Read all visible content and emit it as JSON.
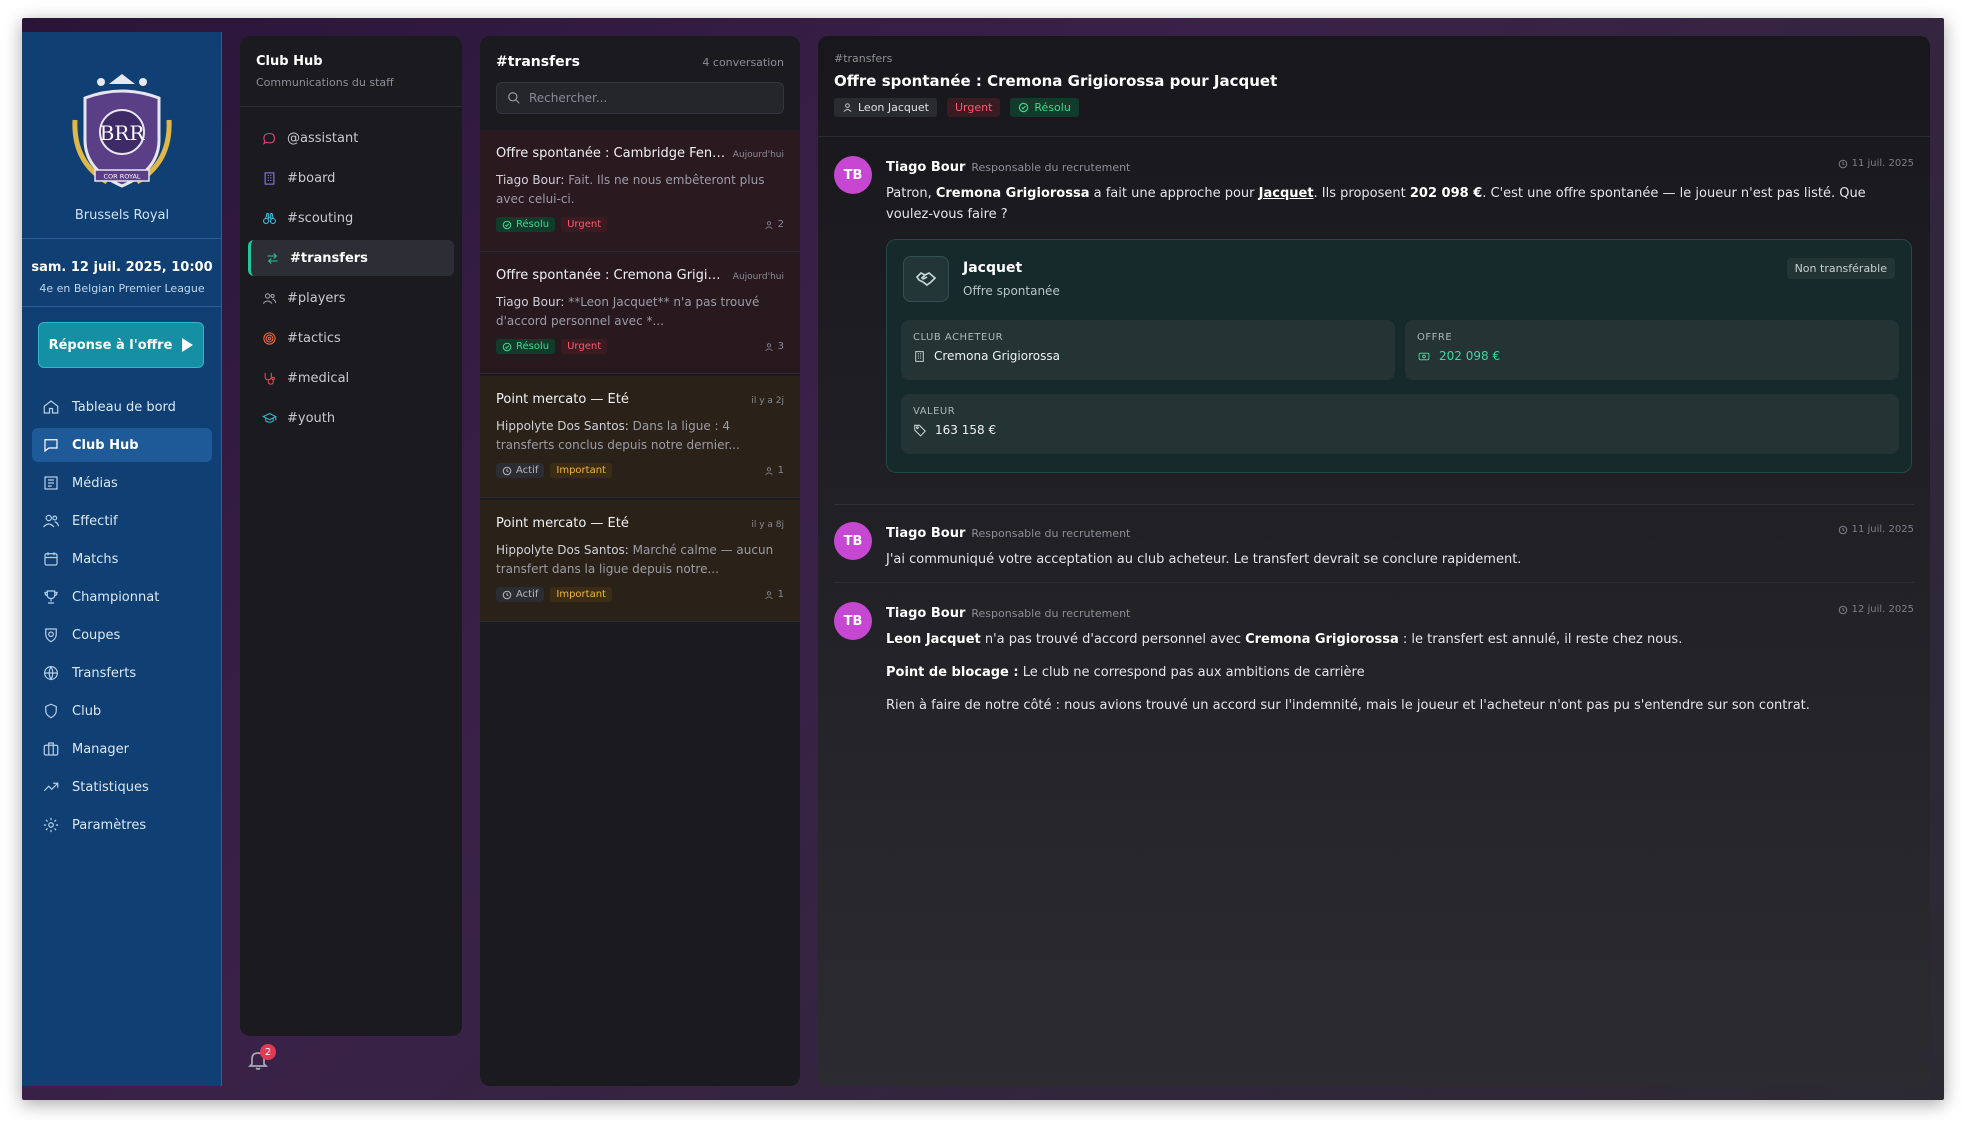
{
  "sidebar": {
    "club_name": "Brussels Royal",
    "crest_text": "BRR",
    "crest_banner": "COR ROYAL",
    "date": "sam. 12 juil. 2025, 10:00",
    "league_position": "4e en Belgian Premier League",
    "cta_label": "Réponse à l'offre",
    "items": [
      {
        "label": "Tableau de bord",
        "icon": "home-icon"
      },
      {
        "label": "Club Hub",
        "icon": "chat-icon",
        "active": true
      },
      {
        "label": "Médias",
        "icon": "newspaper-icon"
      },
      {
        "label": "Effectif",
        "icon": "users-icon"
      },
      {
        "label": "Matchs",
        "icon": "calendar-icon"
      },
      {
        "label": "Championnat",
        "icon": "trophy-icon"
      },
      {
        "label": "Coupes",
        "icon": "shield-award-icon"
      },
      {
        "label": "Transferts",
        "icon": "globe-icon"
      },
      {
        "label": "Club",
        "icon": "shield-icon"
      },
      {
        "label": "Manager",
        "icon": "briefcase-icon"
      },
      {
        "label": "Statistiques",
        "icon": "trend-icon"
      },
      {
        "label": "Paramètres",
        "icon": "gear-icon"
      }
    ]
  },
  "channels": {
    "title": "Club Hub",
    "subtitle": "Communications du staff",
    "items": [
      {
        "label": "@assistant",
        "color": "#e0457a"
      },
      {
        "label": "#board",
        "color": "#8a7cf0"
      },
      {
        "label": "#scouting",
        "color": "#3cc4e8"
      },
      {
        "label": "#transfers",
        "color": "#22c6a0",
        "active": true
      },
      {
        "label": "#players",
        "color": "#a0a0b0"
      },
      {
        "label": "#tactics",
        "color": "#f06a3a"
      },
      {
        "label": "#medical",
        "color": "#f0455a"
      },
      {
        "label": "#youth",
        "color": "#2ab8c8"
      }
    ],
    "notifications": "2"
  },
  "conversations": {
    "title": "#transfers",
    "count": "4 conversation",
    "search_placeholder": "Rechercher...",
    "items": [
      {
        "title": "Offre spontanée : Cambridge Fen ...",
        "time": "Aujourd'hui",
        "author": "Tiago Bour:",
        "preview": " Fait. Ils ne nous embêteront plus avec celui-ci.",
        "status": "Résolu",
        "priority": "Urgent",
        "users": "2"
      },
      {
        "title": "Offre spontanée : Cremona Grigio...",
        "time": "Aujourd'hui",
        "author": "Tiago Bour:",
        "preview": " **Leon Jacquet** n'a pas trouvé d'accord personnel avec *...",
        "status": "Résolu",
        "priority": "Urgent",
        "users": "3"
      },
      {
        "title": "Point mercato — Été",
        "time": "il y a 2j",
        "author": "Hippolyte Dos Santos:",
        "preview": " Dans la ligue : 4 transferts conclus depuis notre dernier...",
        "status": "Actif",
        "priority": "Important",
        "users": "1"
      },
      {
        "title": "Point mercato — Été",
        "time": "il y a 8j",
        "author": "Hippolyte Dos Santos:",
        "preview": " Marché calme — aucun transfert dans la ligue depuis notre...",
        "status": "Actif",
        "priority": "Important",
        "users": "1"
      }
    ]
  },
  "thread": {
    "channel": "#transfers",
    "title": "Offre spontanée : Cremona Grigiorossa pour Jacquet",
    "tags": {
      "user": "Leon Jacquet",
      "priority": "Urgent",
      "status": "Résolu"
    },
    "messages": [
      {
        "initials": "TB",
        "author": "Tiago Bour",
        "role": "Responsable du recrutement",
        "time": "11 juil. 2025",
        "parts": [
          "Patron, ",
          "Cremona Grigiorossa",
          " a fait une approche pour ",
          "Jacquet",
          ". Ils proposent ",
          "202 098 €",
          ". C'est une offre spontanée — le joueur n'est pas listé. Que voulez-vous faire ?"
        ]
      },
      {
        "initials": "TB",
        "author": "Tiago Bour",
        "role": "Responsable du recrutement",
        "time": "11 juil. 2025",
        "text": "J'ai communiqué votre acceptation au club acheteur. Le transfert devrait se conclure rapidement."
      },
      {
        "initials": "TB",
        "author": "Tiago Bour",
        "role": "Responsable du recrutement",
        "time": "12 juil. 2025",
        "p1": [
          "Leon Jacquet",
          " n'a pas trouvé d'accord personnel avec ",
          "Cremona Grigiorossa",
          " : le transfert est annulé, il reste chez nous."
        ],
        "p2": [
          "Point de blocage :",
          " Le club ne correspond pas aux ambitions de carrière"
        ],
        "p3": "Rien à faire de notre côté : nous avions trouvé un accord sur l'indemnité, mais le joueur et l'acheteur n'ont pas pu s'entendre sur son contrat."
      }
    ],
    "card": {
      "player": "Jacquet",
      "type": "Offre spontanée",
      "status": "Non transférable",
      "buyer_label": "CLUB ACHETEUR",
      "buyer": "Cremona Grigiorossa",
      "offer_label": "OFFRE",
      "offer": "202 098 €",
      "value_label": "VALEUR",
      "value": "163 158 €"
    }
  }
}
